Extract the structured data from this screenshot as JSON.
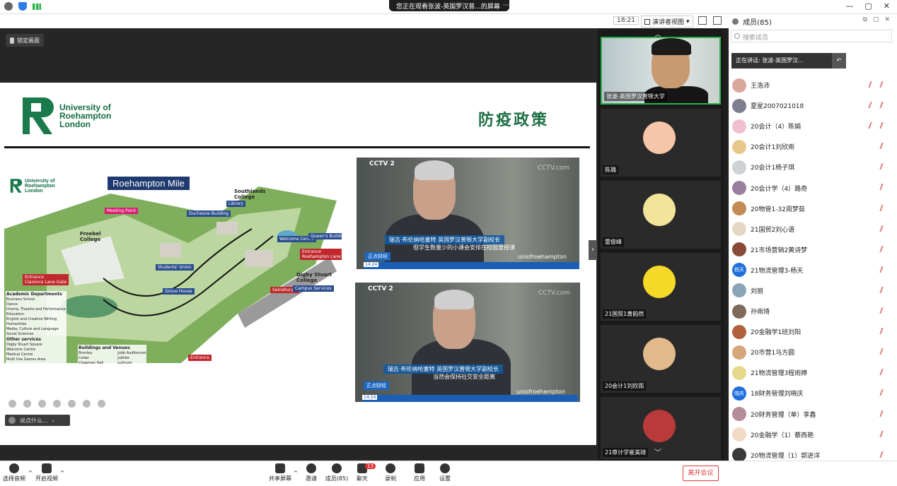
{
  "top": {
    "viewing_text": "您正在观看张波-英国罗汉普...的屏幕",
    "dots": "⋯",
    "window_controls": [
      "—",
      "▢",
      "✕"
    ]
  },
  "subbar": {
    "time": "18:21",
    "view_mode": "演讲者视图",
    "members_title": "成员(85)",
    "members_window_controls": [
      "⧉",
      "▢",
      "✕"
    ]
  },
  "share": {
    "pin_label": "锁定画面",
    "chat_placeholder": "说点什么...",
    "chat_collapse": "‹",
    "collapse_arrow": "›"
  },
  "slide": {
    "logo_text": [
      "University of",
      "Roehampton",
      "London"
    ],
    "title": "防疫政策",
    "map": {
      "title": "Roehampton Mile",
      "logo_text": [
        "University of",
        "Roehampton",
        "London"
      ],
      "labels": {
        "froebel": "Froebel\nCollege",
        "southlands": "Southlands\nCollege",
        "digby": "Digby Stuart\nCollege",
        "meeting": "Meeting Point",
        "duchesne": "Duchesne Building",
        "library": "Library",
        "welcome": "Welcome Centre",
        "queens": "Queen's Building",
        "students_union": "Students' Union",
        "grove": "Grove House",
        "entrance1": "Entrance\nClarence Lane Gate",
        "entrance2": "Entrance\nRoehampton Lane Gate",
        "sainsburys": "Sainsbury's",
        "campus_services": "Campus Services",
        "entrance3": "Entrance"
      },
      "legend": {
        "academic_heading": "Academic Departments",
        "academic": [
          "Business School",
          "Dance",
          "Drama, Theatre and Performance",
          "Education",
          "English and Creative Writing",
          "Humanities",
          "Media, Culture and Language",
          "Social Sciences"
        ],
        "other_heading": "Other services",
        "other": [
          "Digby Stuart Square",
          "Welcome Centre",
          "Medical Centre",
          "Multi Use Games Area"
        ],
        "buildings_heading": "Buildings and Venues",
        "buildings": [
          "Bronfey",
          "Cedar",
          "Chapman Hall",
          "Jubb Auditorium",
          "Jubilee",
          "Lutinum"
        ]
      }
    },
    "videos": [
      {
        "cctv": "CCTV 2",
        "cctv_right": "CCTV.com",
        "caption_name": "瑞吉·布伦纳哈塞特   英国罗汉普顿大学副校长",
        "caption_text": "但学生数量少的小课会安排在校园里授课",
        "news": "正点财经",
        "time": "14:24",
        "watermark": "uniofroehampton"
      },
      {
        "cctv": "CCTV 2",
        "cctv_right": "CCTV.com",
        "caption_name": "瑞吉·布伦纳哈塞特   英国罗汉普顿大学副校长",
        "caption_text": "当然会保持社交安全距离",
        "news": "正点财经",
        "time": "14:24",
        "watermark": "uniofroehampton"
      }
    ]
  },
  "thumbs": [
    {
      "name": "张波-英国罗汉普顿大学"
    },
    {
      "name": "陈璐"
    },
    {
      "name": "雷俊峰"
    },
    {
      "name": "21国贸1黄韵然"
    },
    {
      "name": "20会计1刘欣雨"
    },
    {
      "name": "21审计学崔美琦"
    }
  ],
  "panel": {
    "search_placeholder": "搜索成员",
    "speaking": "正在讲话: 张波-英国罗汉...",
    "speaking_back": "↶",
    "members": [
      {
        "name": "王浩沛",
        "color": "#d9a89b"
      },
      {
        "name": "夏星2007021018",
        "color": "#7f7f8f"
      },
      {
        "name": "20会计（4）陈娟",
        "color": "#f0c0d0"
      },
      {
        "name": "20会计1刘欣雨",
        "color": "#e8c88a"
      },
      {
        "name": "20会计1杨子琪",
        "color": "#ccd2d6"
      },
      {
        "name": "20会计学（4）路奇",
        "color": "#9b7fa0"
      },
      {
        "name": "20物管1-32周梦茹",
        "color": "#c28a55"
      },
      {
        "name": "21国贸2刘心语",
        "color": "#e4d8c4"
      },
      {
        "name": "21市场营销2黄诗梦",
        "color": "#8a4a3a"
      },
      {
        "name": "21物流管理3-杨天",
        "color": "#1f6fdc",
        "initials": "杨天"
      },
      {
        "name": "刘丽",
        "color": "#8aa4b8"
      },
      {
        "name": "孙雨琦",
        "color": "#7e6a5a"
      },
      {
        "name": "20金融学1班刘阳",
        "color": "#b0603a"
      },
      {
        "name": "20市营1马方圆",
        "color": "#d6a57a"
      },
      {
        "name": "21物流管理3程雨婷",
        "color": "#e6d98a"
      },
      {
        "name": "18财务管理刘晓庆",
        "color": "#1f6fdc",
        "initials": "晓庆"
      },
      {
        "name": "20财务管理（单）李鑫",
        "color": "#b48c9a"
      },
      {
        "name": "20金融学（1）蔡西艳",
        "color": "#f2dac4"
      },
      {
        "name": "20物流管理（1）郭进洋",
        "color": "#3a3a3a"
      }
    ]
  },
  "bottom": {
    "audio": "选择音频",
    "video": "开启视频",
    "share": "共享屏幕",
    "invite": "邀请",
    "members": "成员(85)",
    "chat": "聊天",
    "chat_badge": "13",
    "record": "录制",
    "apps": "应用",
    "settings": "设置",
    "leave": "离开会议"
  }
}
